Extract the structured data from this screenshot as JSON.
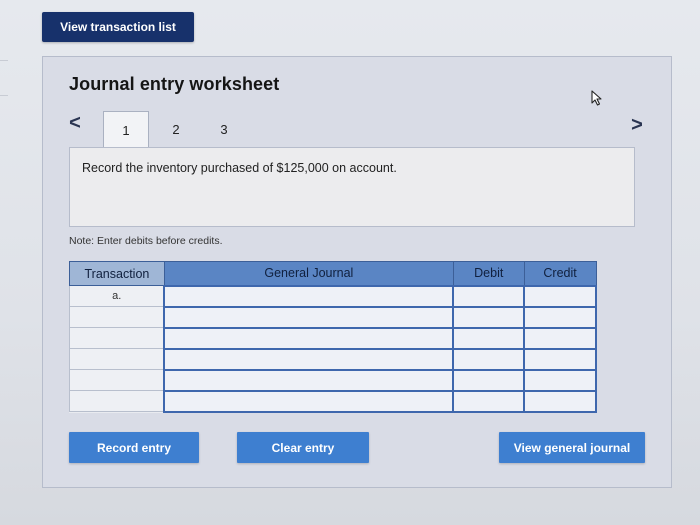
{
  "header": {
    "view_transaction_list": "View transaction list"
  },
  "worksheet": {
    "title": "Journal entry worksheet",
    "nav_prev": "<",
    "nav_next": ">",
    "tabs": [
      "1",
      "2",
      "3"
    ],
    "active_tab": "1",
    "prompt": "Record the inventory purchased of $125,000 on account.",
    "note": "Note: Enter debits before credits."
  },
  "table": {
    "headers": [
      "Transaction",
      "General Journal",
      "Debit",
      "Credit"
    ],
    "rows": [
      {
        "transaction": "a.",
        "general_journal": "",
        "debit": "",
        "credit": ""
      },
      {
        "transaction": "",
        "general_journal": "",
        "debit": "",
        "credit": ""
      },
      {
        "transaction": "",
        "general_journal": "",
        "debit": "",
        "credit": ""
      },
      {
        "transaction": "",
        "general_journal": "",
        "debit": "",
        "credit": ""
      },
      {
        "transaction": "",
        "general_journal": "",
        "debit": "",
        "credit": ""
      },
      {
        "transaction": "",
        "general_journal": "",
        "debit": "",
        "credit": ""
      }
    ]
  },
  "buttons": {
    "record_entry": "Record entry",
    "clear_entry": "Clear entry",
    "view_general_journal": "View general journal"
  },
  "colors": {
    "primary_button": "#3e7fd0",
    "header_button": "#17316b",
    "table_header": "#5a85c4"
  }
}
